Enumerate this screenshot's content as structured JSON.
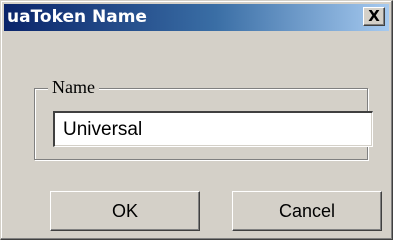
{
  "window": {
    "title": "uaToken Name",
    "close_label": "X"
  },
  "group": {
    "label": "Name"
  },
  "name_field": {
    "value": "Universal"
  },
  "buttons": {
    "ok_label": "OK",
    "cancel_label": "Cancel"
  },
  "colors": {
    "title_gradient_start": "#0a246a",
    "title_gradient_end": "#a6caf0",
    "dialog_face": "#d4d0c8"
  }
}
